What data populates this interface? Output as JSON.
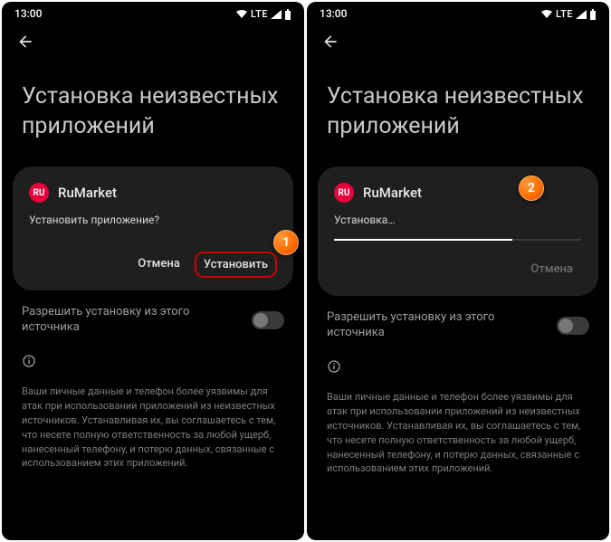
{
  "left": {
    "status": {
      "time": "13:00",
      "net": "LTE"
    },
    "title": "Установка неизвестных приложений",
    "dialog": {
      "app_icon_text": "RU",
      "app_name": "RuMarket",
      "message": "Установить приложение?",
      "cancel": "Отмена",
      "install": "Установить"
    },
    "marker": "1",
    "permission": "Разрешить установку из этого источника",
    "body": "Ваши личные данные и телефон более уязвимы для атак при использовании приложений из неизвестных источников. Устанавливая их, вы соглашаетесь с тем, что несете полную ответственность за любой ущерб, нанесенный телефону, и потерю данных, связанные с использованием этих приложений."
  },
  "right": {
    "status": {
      "time": "13:00",
      "net": "LTE"
    },
    "title": "Установка неизвестных приложений",
    "dialog": {
      "app_icon_text": "RU",
      "app_name": "RuMarket",
      "message": "Установка…",
      "cancel": "Отмена"
    },
    "marker": "2",
    "permission": "Разрешить установку из этого источника",
    "body": "Ваши личные данные и телефон более уязвимы для атак при использовании приложений из неизвестных источников. Устанавливая их, вы соглашаетесь с тем, что несете полную ответственность за любой ущерб, нанесенный телефону, и потерю данных, связанные с использованием этих приложений."
  }
}
